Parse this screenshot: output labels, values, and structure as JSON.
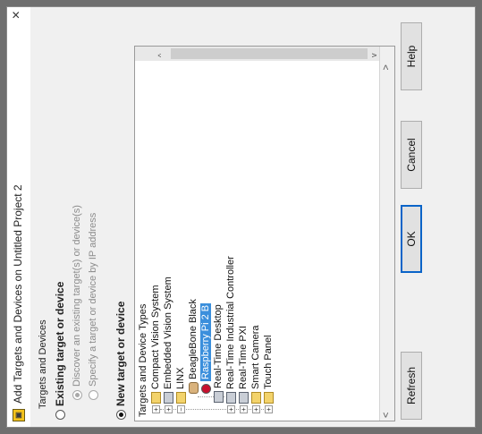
{
  "window": {
    "title": "Add Targets and Devices on Untitled Project 2",
    "close_glyph": "×",
    "icon": "labview-project-icon"
  },
  "targets_section": {
    "label": "Targets and Devices",
    "existing_label": "Existing target or device",
    "discover_label": "Discover an existing target(s) or device(s)",
    "specify_label": "Specify a target or device by IP address",
    "new_label": "New target or device"
  },
  "tree": {
    "items": [
      {
        "label": "Targets and Device Types",
        "icon": "none"
      },
      {
        "label": "Compact Vision System",
        "icon": "folder-icon"
      },
      {
        "label": "Embedded Vision System",
        "icon": "device-icon"
      },
      {
        "label": "LINX",
        "icon": "folder-icon"
      },
      {
        "label": "BeagleBone Black",
        "icon": "beaglebone-icon"
      },
      {
        "label": "Raspberry Pi 2 B",
        "icon": "raspberry-pi-icon",
        "selected": true
      },
      {
        "label": "Real-Time Desktop",
        "icon": "device-icon"
      },
      {
        "label": "Real-Time Industrial Controller",
        "icon": "device-icon"
      },
      {
        "label": "Real-Time PXI",
        "icon": "device-icon"
      },
      {
        "label": "Smart Camera",
        "icon": "folder-icon"
      },
      {
        "label": "Touch Panel",
        "icon": "folder-icon"
      }
    ],
    "scroll_up": "^",
    "scroll_down": "v",
    "scroll_left": "<",
    "scroll_right": ">"
  },
  "buttons": {
    "refresh": "Refresh",
    "ok": "OK",
    "cancel": "Cancel",
    "help": "Help"
  },
  "colors": {
    "selection": "#3b8fdc",
    "default_button_border": "#0a64c8"
  }
}
